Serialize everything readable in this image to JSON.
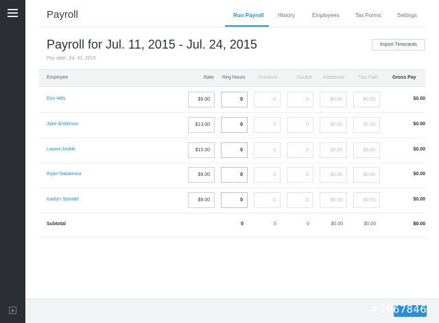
{
  "header": {
    "title": "Payroll",
    "tabs": [
      {
        "label": "Run Payroll",
        "active": true
      },
      {
        "label": "History"
      },
      {
        "label": "Employees"
      },
      {
        "label": "Tax Forms"
      },
      {
        "label": "Settings"
      }
    ]
  },
  "page": {
    "title": "Payroll for Jul. 11, 2015 - Jul. 24, 2015",
    "pay_date": "Pay date: Jul. 31, 2015",
    "import_button": "Import Timecards"
  },
  "table": {
    "columns": [
      "Employee",
      "Rate",
      "Reg Hours",
      "Overtime",
      "Double",
      "Additional",
      "Tips Paid",
      "Gross Pay"
    ],
    "rows": [
      {
        "employee": "Erin Hills",
        "rate": "$9.00",
        "reg_hours": "0",
        "overtime": "0",
        "double": "0",
        "additional": "$0.00",
        "tips_paid": "$0.00",
        "gross_pay": "$0.00"
      },
      {
        "employee": "Jake Anderson",
        "rate": "$13.00",
        "reg_hours": "0",
        "overtime": "0",
        "double": "0",
        "additional": "$0.00",
        "tips_paid": "$0.00",
        "gross_pay": "$0.00"
      },
      {
        "employee": "Lauren Noble",
        "rate": "$15.00",
        "reg_hours": "0",
        "overtime": "0",
        "double": "0",
        "additional": "$0.00",
        "tips_paid": "$0.00",
        "gross_pay": "$0.00"
      },
      {
        "employee": "Ryan Nakamura",
        "rate": "$9.00",
        "reg_hours": "0",
        "overtime": "0",
        "double": "0",
        "additional": "$0.00",
        "tips_paid": "$0.00",
        "gross_pay": "$0.00"
      },
      {
        "employee": "Kaitlyn Spindel",
        "rate": "$9.00",
        "reg_hours": "0",
        "overtime": "0",
        "double": "0",
        "additional": "$0.00",
        "tips_paid": "$0.00",
        "gross_pay": "$0.00"
      }
    ],
    "subtotal": {
      "label": "Subtotal",
      "reg_hours": "0",
      "overtime": "0",
      "double": "0",
      "additional": "$0.00",
      "tips_paid": "$0.00",
      "gross_pay": "$0.00"
    }
  },
  "watermark": "#2967846",
  "colors": {
    "accent": "#2b8fd6",
    "sidebar": "#2b2f34"
  },
  "icons": {
    "menu": "hamburger-menu-icon",
    "collapse": "collapse-sidebar-icon"
  }
}
